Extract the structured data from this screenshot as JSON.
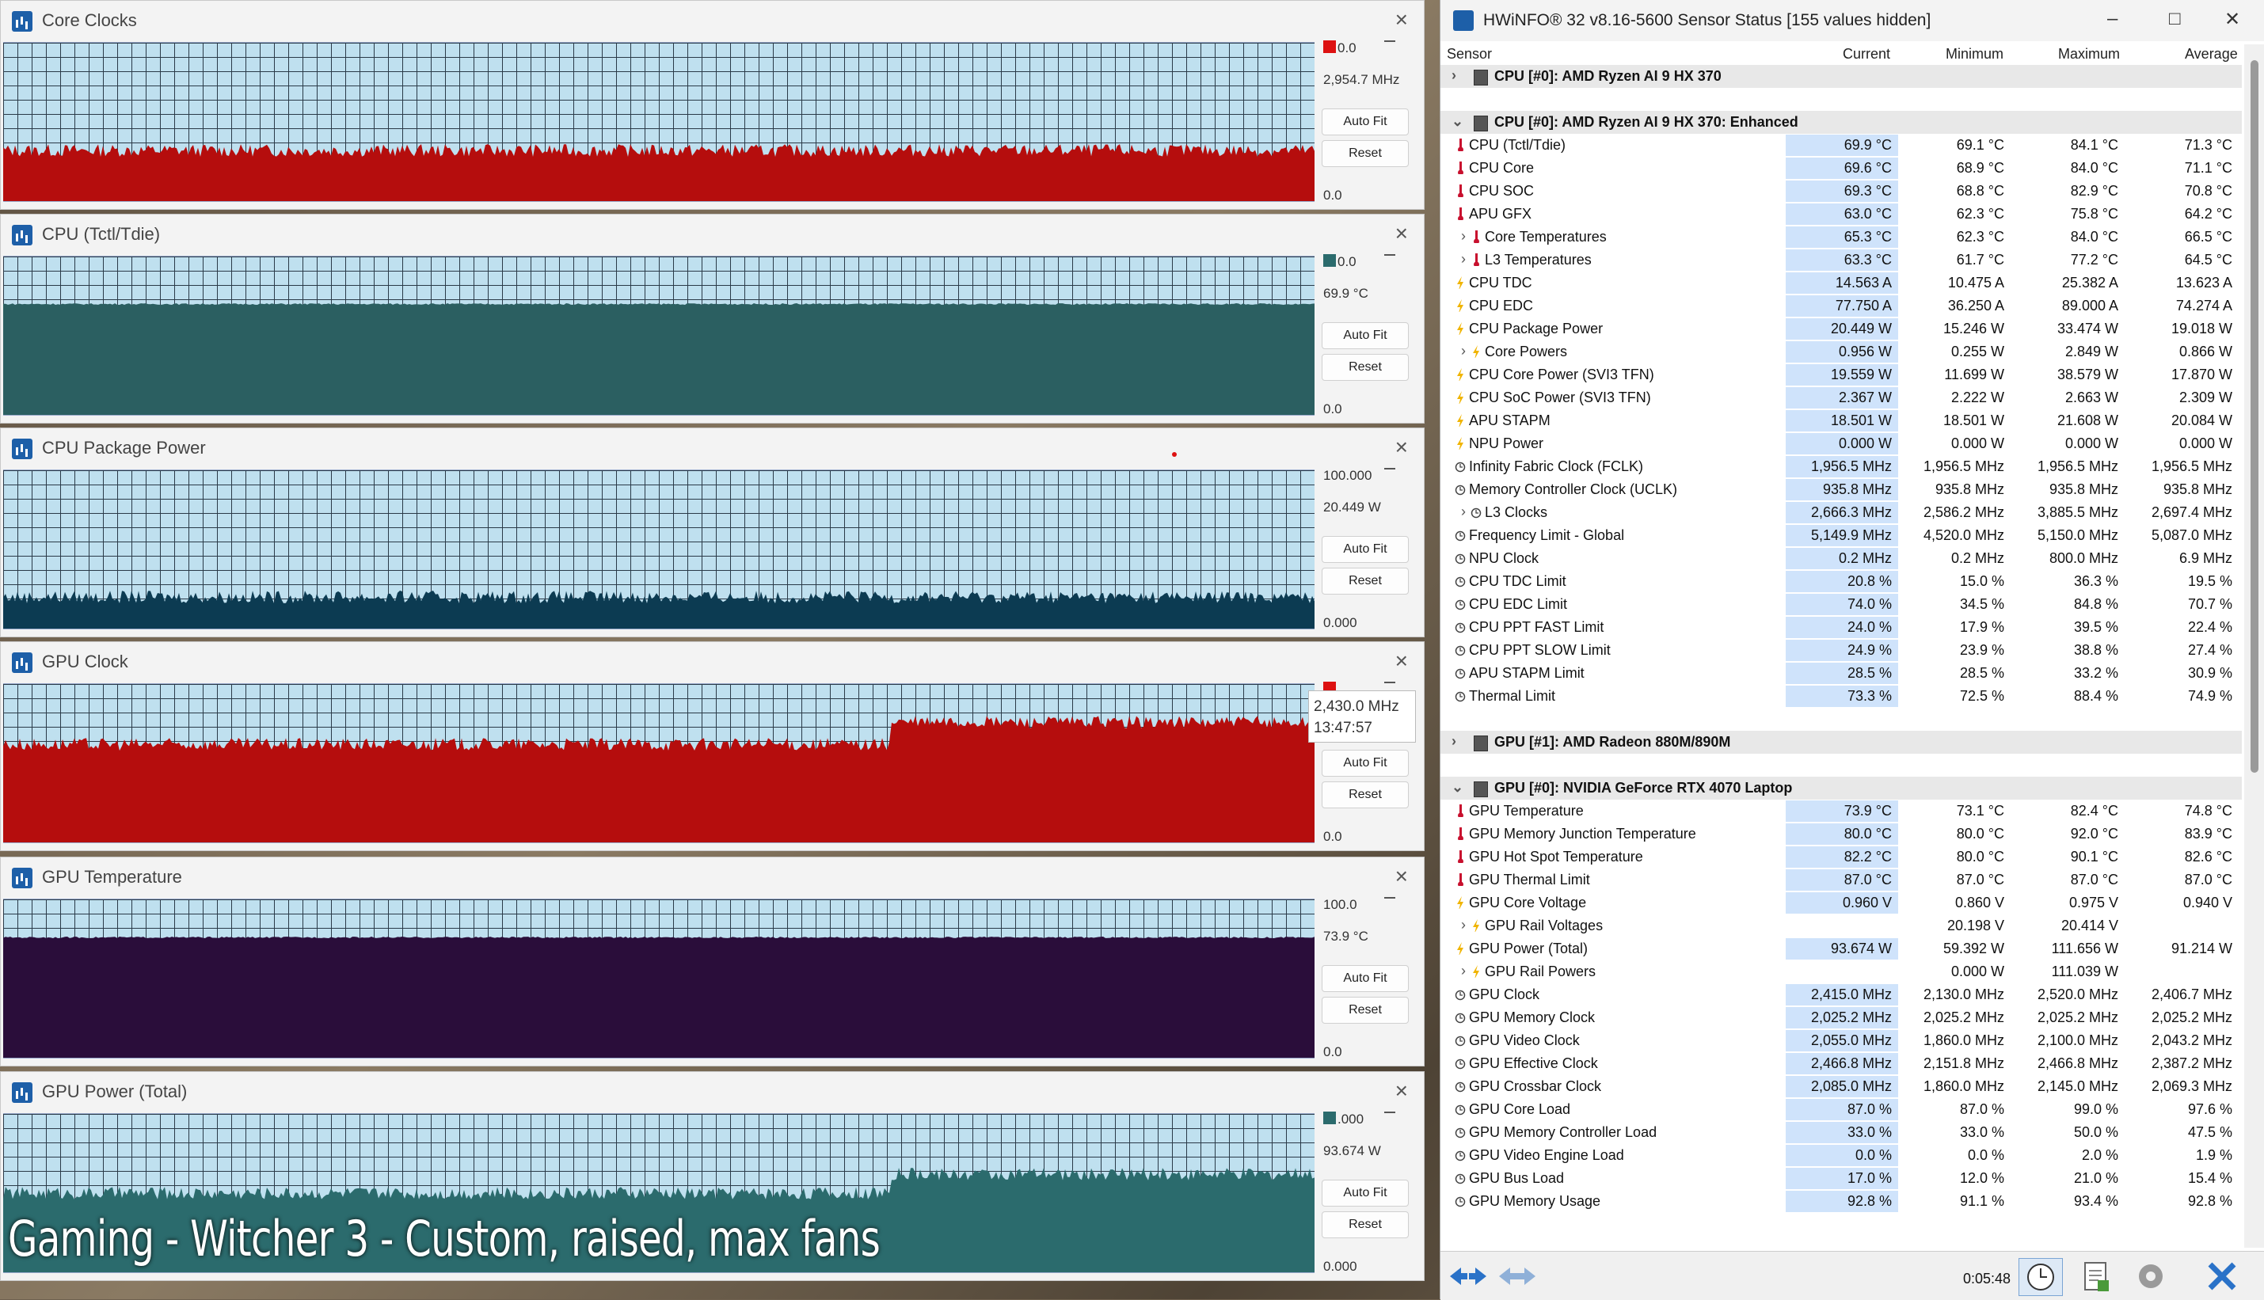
{
  "caption": "Gaming - Witcher 3 - Custom, raised, max fans",
  "graphs": [
    {
      "title": "Core Clocks",
      "top_value": "0.0",
      "current": "2,954.7 MHz",
      "min_value": "0.0",
      "auto_fit": "Auto Fit",
      "reset": "Reset",
      "color": "#b50d0d",
      "fill": 0.32,
      "swatch": "#d11"
    },
    {
      "title": "CPU (Tctl/Tdie)",
      "top_value": "0.0",
      "current": "69.9 °C",
      "min_value": "0.0",
      "auto_fit": "Auto Fit",
      "reset": "Reset",
      "color": "#2b5f61",
      "fill": 0.7,
      "swatch": "#2b6b6d"
    },
    {
      "title": "CPU Package Power",
      "top_value": "100.000",
      "current": "20.449 W",
      "min_value": "0.000",
      "auto_fit": "Auto Fit",
      "reset": "Reset",
      "color": "#0c3b52",
      "fill": 0.2,
      "swatch": ""
    },
    {
      "title": "GPU Clock",
      "top_value": "",
      "current": "",
      "min_value": "0.0",
      "auto_fit": "Auto Fit",
      "reset": "Reset",
      "color": "#b50d0d",
      "fill": 0.62,
      "swatch": "#d11"
    },
    {
      "title": "GPU Temperature",
      "top_value": "100.0",
      "current": "73.9 °C",
      "min_value": "0.0",
      "auto_fit": "Auto Fit",
      "reset": "Reset",
      "color": "#2a0d3a",
      "fill": 0.76,
      "swatch": ""
    },
    {
      "title": "GPU Power (Total)",
      "top_value": ".000",
      "current": "93.674 W",
      "min_value": "0.000",
      "auto_fit": "Auto Fit",
      "reset": "Reset",
      "color": "#2b6b6d",
      "fill": 0.5,
      "swatch": "#2b6b6d"
    }
  ],
  "tooltip": {
    "value": "2,430.0 MHz",
    "time": "13:47:57"
  },
  "hwinfo": {
    "title": "HWiNFO® 32 v8.16-5600 Sensor Status [155 values hidden]",
    "columns": {
      "sensor": "Sensor",
      "current": "Current",
      "minimum": "Minimum",
      "maximum": "Maximum",
      "average": "Average"
    },
    "timer": "0:05:48",
    "rows": [
      {
        "type": "group",
        "expand": ">",
        "name": "CPU [#0]: AMD Ryzen AI 9 HX 370"
      },
      {
        "type": "blank"
      },
      {
        "type": "group",
        "expand": "v",
        "name": "CPU [#0]: AMD Ryzen AI 9 HX 370: Enhanced"
      },
      {
        "type": "s",
        "icon": "temp",
        "name": "CPU (Tctl/Tdie)",
        "cur": "69.9 °C",
        "min": "69.1 °C",
        "max": "84.1 °C",
        "avg": "71.3 °C"
      },
      {
        "type": "s",
        "icon": "temp",
        "name": "CPU Core",
        "cur": "69.6 °C",
        "min": "68.9 °C",
        "max": "84.0 °C",
        "avg": "71.1 °C"
      },
      {
        "type": "s",
        "icon": "temp",
        "name": "CPU SOC",
        "cur": "69.3 °C",
        "min": "68.8 °C",
        "max": "82.9 °C",
        "avg": "70.8 °C"
      },
      {
        "type": "s",
        "icon": "temp",
        "name": "APU GFX",
        "cur": "63.0 °C",
        "min": "62.3 °C",
        "max": "75.8 °C",
        "avg": "64.2 °C"
      },
      {
        "type": "s",
        "icon": "temp",
        "sub": true,
        "name": "Core Temperatures",
        "cur": "65.3 °C",
        "min": "62.3 °C",
        "max": "84.0 °C",
        "avg": "66.5 °C"
      },
      {
        "type": "s",
        "icon": "temp",
        "sub": true,
        "name": "L3 Temperatures",
        "cur": "63.3 °C",
        "min": "61.7 °C",
        "max": "77.2 °C",
        "avg": "64.5 °C"
      },
      {
        "type": "s",
        "icon": "bolt",
        "name": "CPU TDC",
        "cur": "14.563 A",
        "min": "10.475 A",
        "max": "25.382 A",
        "avg": "13.623 A"
      },
      {
        "type": "s",
        "icon": "bolt",
        "name": "CPU EDC",
        "cur": "77.750 A",
        "min": "36.250 A",
        "max": "89.000 A",
        "avg": "74.274 A"
      },
      {
        "type": "s",
        "icon": "bolt",
        "name": "CPU Package Power",
        "cur": "20.449 W",
        "min": "15.246 W",
        "max": "33.474 W",
        "avg": "19.018 W"
      },
      {
        "type": "s",
        "icon": "bolt",
        "sub": true,
        "name": "Core Powers",
        "cur": "0.956 W",
        "min": "0.255 W",
        "max": "2.849 W",
        "avg": "0.866 W"
      },
      {
        "type": "s",
        "icon": "bolt",
        "name": "CPU Core Power (SVI3 TFN)",
        "cur": "19.559 W",
        "min": "11.699 W",
        "max": "38.579 W",
        "avg": "17.870 W"
      },
      {
        "type": "s",
        "icon": "bolt",
        "name": "CPU SoC Power (SVI3 TFN)",
        "cur": "2.367 W",
        "min": "2.222 W",
        "max": "2.663 W",
        "avg": "2.309 W"
      },
      {
        "type": "s",
        "icon": "bolt",
        "name": "APU STAPM",
        "cur": "18.501 W",
        "min": "18.501 W",
        "max": "21.608 W",
        "avg": "20.084 W"
      },
      {
        "type": "s",
        "icon": "bolt",
        "name": "NPU Power",
        "cur": "0.000 W",
        "min": "0.000 W",
        "max": "0.000 W",
        "avg": "0.000 W"
      },
      {
        "type": "s",
        "icon": "clock",
        "name": "Infinity Fabric Clock (FCLK)",
        "cur": "1,956.5 MHz",
        "min": "1,956.5 MHz",
        "max": "1,956.5 MHz",
        "avg": "1,956.5 MHz"
      },
      {
        "type": "s",
        "icon": "clock",
        "name": "Memory Controller Clock (UCLK)",
        "cur": "935.8 MHz",
        "min": "935.8 MHz",
        "max": "935.8 MHz",
        "avg": "935.8 MHz"
      },
      {
        "type": "s",
        "icon": "clock",
        "sub": true,
        "name": "L3 Clocks",
        "cur": "2,666.3 MHz",
        "min": "2,586.2 MHz",
        "max": "3,885.5 MHz",
        "avg": "2,697.4 MHz"
      },
      {
        "type": "s",
        "icon": "clock",
        "name": "Frequency Limit - Global",
        "cur": "5,149.9 MHz",
        "min": "4,520.0 MHz",
        "max": "5,150.0 MHz",
        "avg": "5,087.0 MHz"
      },
      {
        "type": "s",
        "icon": "clock",
        "name": "NPU Clock",
        "cur": "0.2 MHz",
        "min": "0.2 MHz",
        "max": "800.0 MHz",
        "avg": "6.9 MHz"
      },
      {
        "type": "s",
        "icon": "clock",
        "name": "CPU TDC Limit",
        "cur": "20.8 %",
        "min": "15.0 %",
        "max": "36.3 %",
        "avg": "19.5 %"
      },
      {
        "type": "s",
        "icon": "clock",
        "name": "CPU EDC Limit",
        "cur": "74.0 %",
        "min": "34.5 %",
        "max": "84.8 %",
        "avg": "70.7 %"
      },
      {
        "type": "s",
        "icon": "clock",
        "name": "CPU PPT FAST Limit",
        "cur": "24.0 %",
        "min": "17.9 %",
        "max": "39.5 %",
        "avg": "22.4 %"
      },
      {
        "type": "s",
        "icon": "clock",
        "name": "CPU PPT SLOW Limit",
        "cur": "24.9 %",
        "min": "23.9 %",
        "max": "38.8 %",
        "avg": "27.4 %"
      },
      {
        "type": "s",
        "icon": "clock",
        "name": "APU STAPM Limit",
        "cur": "28.5 %",
        "min": "28.5 %",
        "max": "33.2 %",
        "avg": "30.9 %"
      },
      {
        "type": "s",
        "icon": "clock",
        "name": "Thermal Limit",
        "cur": "73.3 %",
        "min": "72.5 %",
        "max": "88.4 %",
        "avg": "74.9 %"
      },
      {
        "type": "blank"
      },
      {
        "type": "group",
        "expand": ">",
        "name": "GPU [#1]: AMD Radeon 880M/890M"
      },
      {
        "type": "blank"
      },
      {
        "type": "group",
        "expand": "v",
        "name": "GPU [#0]: NVIDIA GeForce RTX 4070 Laptop"
      },
      {
        "type": "s",
        "icon": "temp",
        "name": "GPU Temperature",
        "cur": "73.9 °C",
        "min": "73.1 °C",
        "max": "82.4 °C",
        "avg": "74.8 °C"
      },
      {
        "type": "s",
        "icon": "temp",
        "name": "GPU Memory Junction Temperature",
        "cur": "80.0 °C",
        "min": "80.0 °C",
        "max": "92.0 °C",
        "avg": "83.9 °C"
      },
      {
        "type": "s",
        "icon": "temp",
        "name": "GPU Hot Spot Temperature",
        "cur": "82.2 °C",
        "min": "80.0 °C",
        "max": "90.1 °C",
        "avg": "82.6 °C"
      },
      {
        "type": "s",
        "icon": "temp",
        "name": "GPU Thermal Limit",
        "cur": "87.0 °C",
        "min": "87.0 °C",
        "max": "87.0 °C",
        "avg": "87.0 °C"
      },
      {
        "type": "s",
        "icon": "bolt",
        "name": "GPU Core Voltage",
        "cur": "0.960 V",
        "min": "0.860 V",
        "max": "0.975 V",
        "avg": "0.940 V"
      },
      {
        "type": "s",
        "icon": "bolt",
        "sub": true,
        "name": "GPU Rail Voltages",
        "cur": "",
        "min": "20.198 V",
        "max": "20.414 V",
        "avg": ""
      },
      {
        "type": "s",
        "icon": "bolt",
        "name": "GPU Power (Total)",
        "cur": "93.674 W",
        "min": "59.392 W",
        "max": "111.656 W",
        "avg": "91.214 W"
      },
      {
        "type": "s",
        "icon": "bolt",
        "sub": true,
        "name": "GPU Rail Powers",
        "cur": "",
        "min": "0.000 W",
        "max": "111.039 W",
        "avg": ""
      },
      {
        "type": "s",
        "icon": "clock",
        "name": "GPU Clock",
        "cur": "2,415.0 MHz",
        "min": "2,130.0 MHz",
        "max": "2,520.0 MHz",
        "avg": "2,406.7 MHz"
      },
      {
        "type": "s",
        "icon": "clock",
        "name": "GPU Memory Clock",
        "cur": "2,025.2 MHz",
        "min": "2,025.2 MHz",
        "max": "2,025.2 MHz",
        "avg": "2,025.2 MHz"
      },
      {
        "type": "s",
        "icon": "clock",
        "name": "GPU Video Clock",
        "cur": "2,055.0 MHz",
        "min": "1,860.0 MHz",
        "max": "2,100.0 MHz",
        "avg": "2,043.2 MHz"
      },
      {
        "type": "s",
        "icon": "clock",
        "name": "GPU Effective Clock",
        "cur": "2,466.8 MHz",
        "min": "2,151.8 MHz",
        "max": "2,466.8 MHz",
        "avg": "2,387.2 MHz"
      },
      {
        "type": "s",
        "icon": "clock",
        "name": "GPU Crossbar Clock",
        "cur": "2,085.0 MHz",
        "min": "1,860.0 MHz",
        "max": "2,145.0 MHz",
        "avg": "2,069.3 MHz"
      },
      {
        "type": "s",
        "icon": "clock",
        "name": "GPU Core Load",
        "cur": "87.0 %",
        "min": "87.0 %",
        "max": "99.0 %",
        "avg": "97.6 %"
      },
      {
        "type": "s",
        "icon": "clock",
        "name": "GPU Memory Controller Load",
        "cur": "33.0 %",
        "min": "33.0 %",
        "max": "50.0 %",
        "avg": "47.5 %"
      },
      {
        "type": "s",
        "icon": "clock",
        "name": "GPU Video Engine Load",
        "cur": "0.0 %",
        "min": "0.0 %",
        "max": "2.0 %",
        "avg": "1.9 %"
      },
      {
        "type": "s",
        "icon": "clock",
        "name": "GPU Bus Load",
        "cur": "17.0 %",
        "min": "12.0 %",
        "max": "21.0 %",
        "avg": "15.4 %"
      },
      {
        "type": "s",
        "icon": "clock",
        "name": "GPU Memory Usage",
        "cur": "92.8 %",
        "min": "91.1 %",
        "max": "93.4 %",
        "avg": "92.8 %"
      }
    ]
  }
}
